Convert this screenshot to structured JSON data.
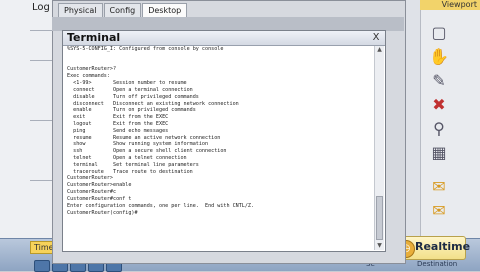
{
  "background": {
    "log_label": "Log",
    "viewport_label": "Viewport",
    "timer_tab_label": "Time",
    "realtime_label": "Realtime",
    "hint_left": "Se",
    "hint_right": "Destination"
  },
  "tabs": [
    {
      "label": "Physical"
    },
    {
      "label": "Config"
    },
    {
      "label": "Desktop"
    }
  ],
  "terminal": {
    "title": "Terminal",
    "close_glyph": "X",
    "lines": [
      "%SYS-5-CONFIG_I: Configured from console by console",
      "",
      "",
      "CustomerRouter>?",
      "Exec commands:",
      "  <1-99>       Session number to resume",
      "  connect      Open a terminal connection",
      "  disable      Turn off privileged commands",
      "  disconnect   Disconnect an existing network connection",
      "  enable       Turn on privileged commands",
      "  exit         Exit from the EXEC",
      "  logout       Exit from the EXEC",
      "  ping         Send echo messages",
      "  resume       Resume an active network connection",
      "  show         Show running system information",
      "  ssh          Open a secure shell client connection",
      "  telnet       Open a telnet connection",
      "  terminal     Set terminal line parameters",
      "  traceroute   Trace route to destination",
      "CustomerRouter>",
      "CustomerRouter>enable",
      "CustomerRouter#c",
      "CustomerRouter#conf t",
      "Enter configuration commands, one per line.  End with CNTL/Z.",
      "CustomerRouter(config)#"
    ]
  }
}
